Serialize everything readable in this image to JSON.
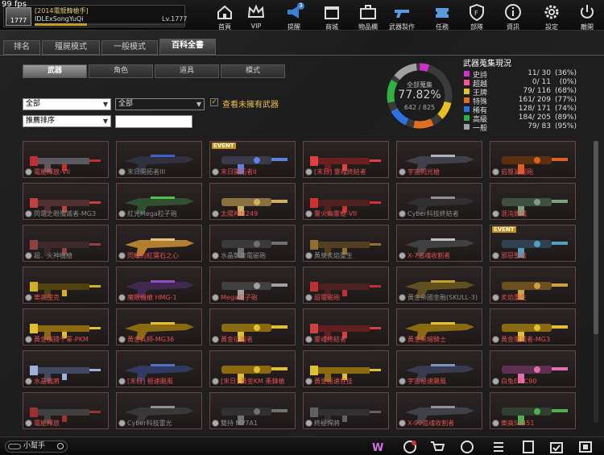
{
  "fps": "99 fps",
  "profile": {
    "rank_label": "1777",
    "clan": "[2014電競韓槍手]",
    "name": "IDLExSongYuQi",
    "level": "Lv.1777",
    "xp_fraction": 0.35
  },
  "nav": [
    {
      "id": "home",
      "label": "首頁",
      "icon": "home-icon"
    },
    {
      "id": "vip",
      "label": "VIP",
      "icon": "crown-icon"
    },
    {
      "id": "notice",
      "label": "提醒",
      "icon": "megaphone-icon",
      "badge": "3"
    },
    {
      "id": "shop",
      "label": "商城",
      "icon": "store-icon"
    },
    {
      "id": "inventory",
      "label": "物品欄",
      "icon": "briefcase-icon"
    },
    {
      "id": "craft",
      "label": "武器製作",
      "icon": "gun-icon"
    },
    {
      "id": "mission",
      "label": "任務",
      "icon": "ticket-icon"
    },
    {
      "id": "clan",
      "label": "部隊",
      "icon": "shield-icon"
    },
    {
      "id": "info",
      "label": "資訊",
      "icon": "info-icon"
    },
    {
      "id": "settings",
      "label": "設定",
      "icon": "gear-icon"
    },
    {
      "id": "exit",
      "label": "離開",
      "icon": "power-icon"
    }
  ],
  "tabs": [
    "排名",
    "殭屍模式",
    "一般模式",
    "百科全書"
  ],
  "subtabs": [
    "武器",
    "角色",
    "道具",
    "模式"
  ],
  "filters": {
    "filter1": "全部",
    "filter2": "全部",
    "sort": "推薦排序",
    "search_value": "",
    "show_unowned": "查看未擁有武器"
  },
  "collection": {
    "title": "全部蒐集",
    "percent": "77.82%",
    "count": "642 / 825",
    "stats_title": "武器蒐集現況"
  },
  "stats": [
    {
      "name": "史詩",
      "count": "11/ 30",
      "pct": "(36%)",
      "color": "#d030d0"
    },
    {
      "name": "超越",
      "count": "0/ 11",
      "pct": "(0%)",
      "color": "#ff50a0"
    },
    {
      "name": "王牌",
      "count": "79/ 116",
      "pct": "(68%)",
      "color": "#e8c020"
    },
    {
      "name": "特殊",
      "count": "161/ 209",
      "pct": "(77%)",
      "color": "#e07020"
    },
    {
      "name": "稀有",
      "count": "128/ 171",
      "pct": "(74%)",
      "color": "#3070e0"
    },
    {
      "name": "高級",
      "count": "184/ 205",
      "pct": "(89%)",
      "color": "#30b040"
    },
    {
      "name": "一般",
      "count": "79/ 83",
      "pct": "(95%)",
      "color": "#a0a0a0"
    }
  ],
  "ring_fractions": [
    0.36,
    0.0,
    0.68,
    0.77,
    0.74,
    0.89,
    0.95
  ],
  "weapons": [
    {
      "name": "電能釋放-VII",
      "color": "#5a5a60",
      "accent": "#c03030",
      "event": "",
      "locked": false
    },
    {
      "name": "末日開拓者III",
      "color": "#303040",
      "accent": "#4060d0",
      "event": "",
      "locked": true
    },
    {
      "name": "末日開拓者II",
      "color": "#3a3a48",
      "accent": "#6080e0",
      "event": "EVENT",
      "locked": false
    },
    {
      "name": "[末日] 靈魂終結者",
      "color": "#6a2020",
      "accent": "#e04040",
      "event": "",
      "locked": false
    },
    {
      "name": "宇宙閃光槍",
      "color": "#404048",
      "accent": "#b0b0c0",
      "event": "",
      "locked": false
    },
    {
      "name": "岩漿凝固砲",
      "color": "#5a3010",
      "accent": "#e06020",
      "event": "",
      "locked": false
    },
    {
      "name": "閃電之眼殲滅者-MG3",
      "color": "#503030",
      "accent": "#c04040",
      "event": "",
      "locked": true
    },
    {
      "name": "紅光Mega粒子砲",
      "color": "#305030",
      "accent": "#50c050",
      "event": "",
      "locked": true
    },
    {
      "name": "太陽神M249",
      "color": "#8a7040",
      "accent": "#d0b060",
      "event": "",
      "locked": false
    },
    {
      "name": "靈火幽靈槍-VII",
      "color": "#502020",
      "accent": "#d03030",
      "event": "",
      "locked": false
    },
    {
      "name": "Cyber科技終結者",
      "color": "#303030",
      "accent": "#909090",
      "event": "",
      "locked": true
    },
    {
      "name": "混沌毀滅",
      "color": "#405040",
      "accent": "#80a080",
      "event": "",
      "locked": false
    },
    {
      "name": "超．火神機槍",
      "color": "#3a2a2a",
      "accent": "#904040",
      "event": "",
      "locked": true
    },
    {
      "name": "閃耀的紅寶石之心",
      "color": "#b08030",
      "accent": "#e0c080",
      "event": "",
      "locked": false
    },
    {
      "name": "水晶凱旋電磁砲",
      "color": "#3a3a3a",
      "accent": "#707070",
      "event": "",
      "locked": true
    },
    {
      "name": "黃泉炙焰重生",
      "color": "#504020",
      "accent": "#907030",
      "event": "",
      "locked": true
    },
    {
      "name": "X-7追魂收割者",
      "color": "#404040",
      "accent": "#c0c0c0",
      "event": "",
      "locked": false
    },
    {
      "name": "邪惡聖者",
      "color": "#304050",
      "accent": "#50a0c0",
      "event": "EVENT",
      "locked": false
    },
    {
      "name": "樂高甜克",
      "color": "#504010",
      "accent": "#d0b020",
      "event": "",
      "locked": false
    },
    {
      "name": "魔眼機槍 HMG-1",
      "color": "#402850",
      "accent": "#9050c0",
      "event": "",
      "locked": false
    },
    {
      "name": "Mega粒子砲",
      "color": "#404040",
      "accent": "#a0a0a0",
      "event": "",
      "locked": false
    },
    {
      "name": "超電磁砲",
      "color": "#4a2020",
      "accent": "#c03030",
      "event": "",
      "locked": false
    },
    {
      "name": "黃金帝國金融(SKULL-3)",
      "color": "#605020",
      "accent": "#c0a030",
      "event": "",
      "locked": true
    },
    {
      "name": "炙焰重生",
      "color": "#6a5020",
      "accent": "#d0a040",
      "event": "",
      "locked": false
    },
    {
      "name": "黃金橫掃千軍-PKM",
      "color": "#8a6a10",
      "accent": "#e0c030",
      "event": "",
      "locked": false
    },
    {
      "name": "黃金兵師-MG36",
      "color": "#8a6a10",
      "accent": "#e0c030",
      "event": "",
      "locked": false
    },
    {
      "name": "黃金征服者",
      "color": "#8a6a10",
      "accent": "#e0c030",
      "event": "",
      "locked": false
    },
    {
      "name": "靈魂終結者",
      "color": "#602020",
      "accent": "#d04040",
      "event": "",
      "locked": false
    },
    {
      "name": "黃金黑暗騎士",
      "color": "#8a6a10",
      "accent": "#e0c030",
      "event": "",
      "locked": false
    },
    {
      "name": "黃金殲滅者-MG3",
      "color": "#8a6a10",
      "accent": "#e0c030",
      "event": "",
      "locked": false
    },
    {
      "name": "水晶戰將",
      "color": "#404860",
      "accent": "#a0b0e0",
      "event": "",
      "locked": false
    },
    {
      "name": "[末日] 極速颶風",
      "color": "#303a60",
      "accent": "#5070c0",
      "event": "",
      "locked": false
    },
    {
      "name": "[末日] 黃金KM 衝鋒槍",
      "color": "#8a6a10",
      "accent": "#e0c030",
      "event": "",
      "locked": false
    },
    {
      "name": "黃金極速狂徒",
      "color": "#8a6a10",
      "accent": "#e0c030",
      "event": "",
      "locked": false
    },
    {
      "name": "宇宙極速颶風",
      "color": "#383a50",
      "accent": "#8090c0",
      "event": "",
      "locked": false
    },
    {
      "name": "白兔ES C90",
      "color": "#603050",
      "accent": "#e070b0",
      "event": "",
      "locked": false
    },
    {
      "name": "電能釋放",
      "color": "#404040",
      "accent": "#a03030",
      "event": "",
      "locked": false
    },
    {
      "name": "Cyber科技雷光",
      "color": "#383838",
      "accent": "#909090",
      "event": "",
      "locked": true
    },
    {
      "name": "雙持 MP7A1",
      "color": "#303030",
      "accent": "#707070",
      "event": "",
      "locked": true
    },
    {
      "name": "終極悍將",
      "color": "#303030",
      "accent": "#606060",
      "event": "",
      "locked": true
    },
    {
      "name": "X-90追魂收割者",
      "color": "#404048",
      "accent": "#9090a0",
      "event": "",
      "locked": false
    },
    {
      "name": "樂高S1451",
      "color": "#304030",
      "accent": "#50b050",
      "event": "",
      "locked": false
    }
  ],
  "helper_label": "小幫手",
  "bottom_icons": [
    "shop-w-icon",
    "clock-icon",
    "cart-icon",
    "compass-icon",
    "list-check-icon",
    "bookmark-icon",
    "calendar-icon",
    "film-icon"
  ]
}
